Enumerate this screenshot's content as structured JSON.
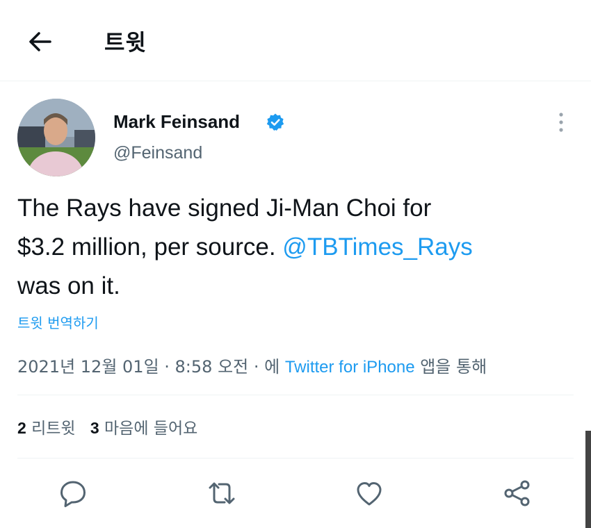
{
  "header": {
    "title": "트윗"
  },
  "tweet": {
    "author_name": "Mark Feinsand",
    "handle": "@Feinsand",
    "text_line1": "The Rays have signed Ji-Man Choi for",
    "text_line2_prefix": "$3.2 million, per source. ",
    "mention": "@TBTimes_Rays",
    "text_line3": "was on it.",
    "translate_label": "트윗 번역하기",
    "timestamp": "2021년 12월 01일 · 8:58 오전 · 에 ",
    "source": "Twitter for iPhone",
    "source_suffix": " 앱을 통해"
  },
  "stats": {
    "retweet_count": "2",
    "retweet_label": "리트윗",
    "like_count": "3",
    "like_label": "마음에 들어요"
  },
  "icons": {
    "back": "arrow-left-icon",
    "verified": "verified-badge-icon",
    "more": "more-vertical-icon",
    "reply": "reply-icon",
    "retweet": "retweet-icon",
    "like": "heart-icon",
    "share": "share-icon"
  },
  "colors": {
    "accent": "#1d9bf0",
    "text": "#0f1419",
    "muted": "#536471"
  }
}
